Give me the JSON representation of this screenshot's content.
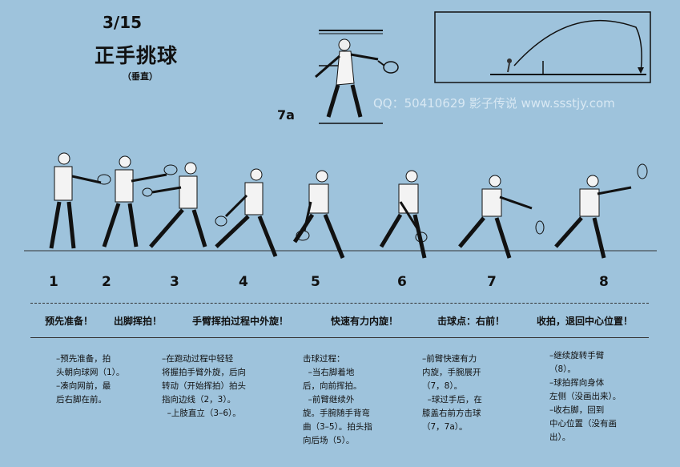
{
  "title": {
    "number": "3/15",
    "main": "正手挑球",
    "sub": "（垂直）"
  },
  "figure_label": "7a",
  "watermark": "QQ：50410629 影子传说 www.ssstjy.com",
  "step_numbers": [
    "1",
    "2",
    "3",
    "4",
    "5",
    "6",
    "7",
    "8"
  ],
  "captions": [
    "预先准备！",
    "出脚挥拍！",
    "手臂挥拍过程中外旋！",
    "快速有力内旋！",
    "击球点：右前！",
    "收拍，退回中心位置！"
  ],
  "descriptions": [
    "–预先准备，拍\n头朝向球网（1）。\n–凑向网前，最\n后右脚在前。",
    "–在跑动过程中轻轻\n将握拍手臂外旋，后向\n转动（开始挥拍）拍头\n指向边线（2，3）。\n  –上肢直立（3–6）。",
    "击球过程：\n  –当右脚着地\n后，向前挥拍。\n  –前臂继续外\n旋。手腕随手背弯\n曲（3–5）。拍头指\n向后场（5）。",
    "–前臂快速有力\n内旋，手腕展开\n（7，8）。\n  –球过手后，在\n膝盖右前方击球\n（7，7a）。",
    "–继续旋转手臂\n（8）。\n–球拍挥向身体\n左侧（没画出来）。\n–收右脚，回到\n中心位置（没有画\n出）。"
  ]
}
